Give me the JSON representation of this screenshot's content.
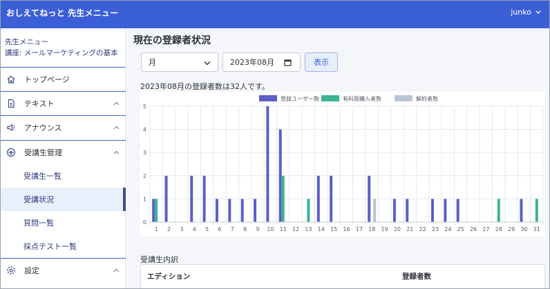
{
  "header": {
    "app_title": "おしえてねっと 先生メニュー",
    "user_name": "junko"
  },
  "sidebar": {
    "heading_line1": "先生メニュー",
    "heading_line2": "講座: メールマーケティングの基本",
    "items": [
      {
        "label": "トップページ",
        "icon": "home-icon"
      },
      {
        "label": "テキスト",
        "icon": "document-icon"
      },
      {
        "label": "アナウンス",
        "icon": "megaphone-icon"
      },
      {
        "label": "受講生管理",
        "icon": "student-icon"
      },
      {
        "label": "設定",
        "icon": "gear-icon"
      }
    ],
    "subitems": [
      {
        "label": "受講生一覧"
      },
      {
        "label": "受講状況"
      },
      {
        "label": "質問一覧"
      },
      {
        "label": "採点テスト一覧"
      }
    ]
  },
  "main": {
    "title": "現在の登録者状況",
    "period_select": "月",
    "month_value": "2023年08月",
    "show_button": "表示",
    "summary": "2023年08月の登録者数は32人です。",
    "section_title": "受講生内訳",
    "table_headers": [
      "エディション",
      "登録者数"
    ]
  },
  "colors": {
    "header": "#3b5fd6",
    "series_registered": "#5b5fc7",
    "series_paid": "#3bb591",
    "series_cancelled": "#b8c4d6"
  },
  "chart_data": {
    "type": "bar",
    "categories": [
      "1",
      "2",
      "3",
      "4",
      "5",
      "6",
      "7",
      "8",
      "9",
      "10",
      "11",
      "12",
      "13",
      "14",
      "15",
      "16",
      "17",
      "18",
      "19",
      "20",
      "21",
      "22",
      "23",
      "24",
      "25",
      "26",
      "27",
      "28",
      "29",
      "30",
      "31"
    ],
    "ylim": [
      0,
      5
    ],
    "yticks": [
      "0",
      "1",
      "2",
      "3",
      "4",
      "5"
    ],
    "legend_position": "top",
    "grid": true,
    "series": [
      {
        "name": "登録ユーザー数",
        "values": [
          1,
          2,
          0,
          2,
          2,
          1,
          1,
          1,
          1,
          5,
          4,
          0,
          0,
          2,
          2,
          0,
          0,
          2,
          0,
          1,
          1,
          0,
          1,
          1,
          1,
          0,
          0,
          0,
          0,
          1,
          0
        ]
      },
      {
        "name": "有料版購入者数",
        "values": [
          1,
          0,
          0,
          0,
          0,
          0,
          0,
          0,
          0,
          0,
          2,
          0,
          1,
          0,
          0,
          0,
          0,
          0,
          0,
          0,
          0,
          0,
          0,
          0,
          0,
          0,
          0,
          1,
          0,
          0,
          1
        ]
      },
      {
        "name": "解約者数",
        "values": [
          0,
          0,
          0,
          0,
          0,
          0,
          0,
          0,
          0,
          0,
          0,
          0,
          0,
          0,
          0,
          0,
          0,
          1,
          0,
          0,
          0,
          0,
          0,
          0,
          0,
          0,
          0,
          0,
          0,
          0,
          0
        ]
      }
    ]
  }
}
